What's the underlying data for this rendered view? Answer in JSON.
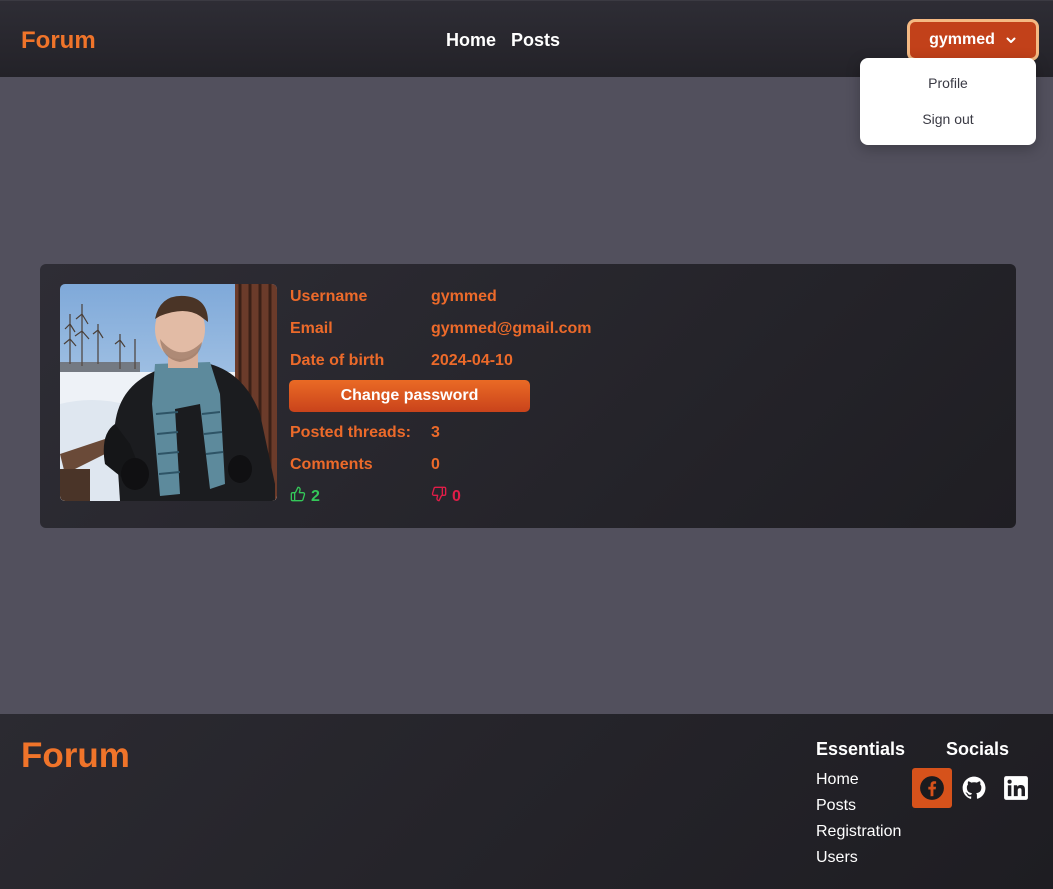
{
  "header": {
    "brand": "Forum",
    "nav": [
      "Home",
      "Posts"
    ],
    "user_button": "gymmed",
    "dropdown": [
      "Profile",
      "Sign out"
    ]
  },
  "profile": {
    "username_label": "Username",
    "username": "gymmed",
    "email_label": "Email",
    "email": "gymmed@gmail.com",
    "dob_label": "Date of birth",
    "dob": "2024-04-10",
    "change_password": "Change password",
    "threads_label": "Posted threads:",
    "threads": "3",
    "comments_label": "Comments",
    "comments": "0",
    "likes": "2",
    "dislikes": "0"
  },
  "footer": {
    "brand": "Forum",
    "essentials_title": "Essentials",
    "essentials": [
      "Home",
      "Posts",
      "Registration",
      "Users"
    ],
    "socials_title": "Socials",
    "socials": [
      "facebook-icon",
      "github-icon",
      "linkedin-icon"
    ]
  },
  "colors": {
    "accent": "#f0742a",
    "button": "#c2411a",
    "background": "#52505d",
    "like": "#34c759",
    "dislike": "#e11d48"
  }
}
